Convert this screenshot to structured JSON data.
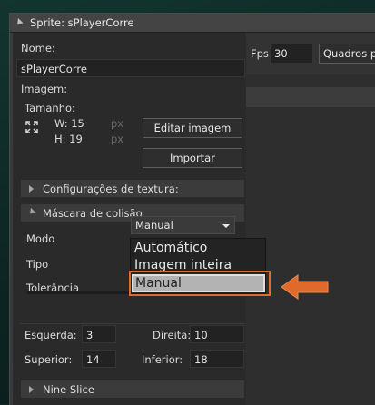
{
  "window": {
    "title": "Sprite: sPlayerCorre"
  },
  "fields": {
    "name_label": "Nome:",
    "name_value": "sPlayerCorre",
    "image_label": "Imagem:",
    "size_label": "Tamanho:",
    "width": "W: 15",
    "height": "H: 19",
    "unit_w": "px",
    "unit_h": "px"
  },
  "buttons": {
    "edit_image": "Editar imagem",
    "import": "Importar"
  },
  "sections": {
    "texture": "Configurações de textura:",
    "collision": "Máscara de colisão",
    "nine_slice": "Nine Slice"
  },
  "collision": {
    "mode_label": "Modo",
    "mode_value": "Manual",
    "type_label": "Tipo",
    "tolerance_label": "Tolerância",
    "left_label": "Esquerda:",
    "left_value": "3",
    "right_label": "Direita:",
    "right_value": "10",
    "top_label": "Superior:",
    "top_value": "14",
    "bottom_label": "Inferior:",
    "bottom_value": "18"
  },
  "dropdown_options": [
    "Automático",
    "Imagem inteira",
    "Manual"
  ],
  "dropdown_selected": "Manual",
  "right_pane": {
    "fps_label": "Fps",
    "fps_value": "30",
    "speed_mode": "Quadros po"
  },
  "colors": {
    "accent": "#e06a2c",
    "background": "#0f2a26",
    "panel": "#2a2a2a"
  },
  "icons": {
    "title_toggle": "collapse-triangle-icon",
    "size_icon": "expand-arrows-icon",
    "annotation": "left-arrow-icon"
  }
}
